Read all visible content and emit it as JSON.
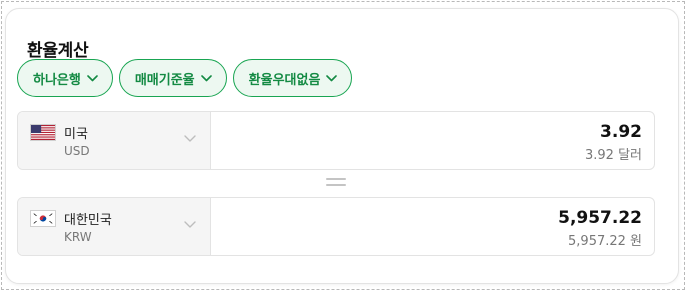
{
  "title": "환율계산",
  "chips": [
    {
      "label": "하나은행"
    },
    {
      "label": "매매기준율"
    },
    {
      "label": "환율우대없음"
    }
  ],
  "from": {
    "currency_name": "미국",
    "currency_code": "USD",
    "flag_icon": "us-flag-icon",
    "amount": "3.92",
    "amount_text": "3.92 달러"
  },
  "to": {
    "currency_name": "대한민국",
    "currency_code": "KRW",
    "flag_icon": "kr-flag-icon",
    "amount": "5,957.22",
    "amount_text": "5,957.22 원"
  },
  "colors": {
    "accent": "#19a552",
    "accent_text": "#138a43",
    "chip_bg": "#edf8f1"
  }
}
